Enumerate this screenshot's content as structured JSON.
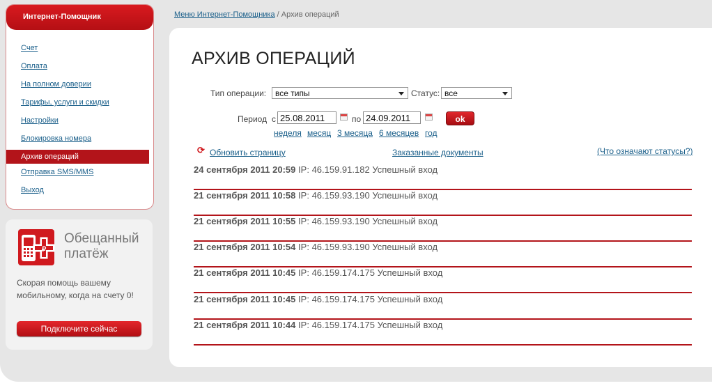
{
  "sidebar": {
    "title": "Интернет-Помощник",
    "items": [
      {
        "label": "Счет"
      },
      {
        "label": "Оплата"
      },
      {
        "label": "На полном доверии"
      },
      {
        "label": "Тарифы, услуги и скидки"
      },
      {
        "label": "Настройки"
      },
      {
        "label": "Блокировка номера"
      },
      {
        "label": "Архив операций",
        "active": true
      },
      {
        "label": "Отправка SMS/MMS"
      },
      {
        "label": "Выход"
      }
    ]
  },
  "promo": {
    "title_line1": "Обещанный",
    "title_line2": "платёж",
    "text": "Скорая помощь вашему мобильному, когда на счету 0!",
    "button": "Подключите сейчас"
  },
  "breadcrumb": {
    "parent": "Меню Интернет-Помощника",
    "separator": "/",
    "current": "Архив операций"
  },
  "page": {
    "title": "АРХИВ ОПЕРАЦИЙ"
  },
  "filters": {
    "type_label": "Тип операции:",
    "type_value": "все типы",
    "status_label": "Статус:",
    "status_value": "все",
    "period_label": "Период",
    "from_label": "с",
    "from_date": "25.08.2011",
    "to_label": "по",
    "to_date": "24.09.2011",
    "ok": "ok",
    "quick_periods": [
      "неделя",
      "месяц",
      "3 месяца",
      "6 месяцев",
      "год"
    ]
  },
  "toolbar": {
    "refresh": "Обновить страницу",
    "documents": "Заказанные документы",
    "statuses_help": "(Что означают статусы?)"
  },
  "operations": [
    {
      "datetime": "24 сентября 2011 20:59",
      "ip_label": "IP:",
      "ip": "46.159.91.182",
      "status": "Успешный вход"
    },
    {
      "datetime": "21 сентября 2011 10:58",
      "ip_label": "IP:",
      "ip": "46.159.93.190",
      "status": "Успешный вход"
    },
    {
      "datetime": "21 сентября 2011 10:55",
      "ip_label": "IP:",
      "ip": "46.159.93.190",
      "status": "Успешный вход"
    },
    {
      "datetime": "21 сентября 2011 10:54",
      "ip_label": "IP:",
      "ip": "46.159.93.190",
      "status": "Успешный вход"
    },
    {
      "datetime": "21 сентября 2011 10:45",
      "ip_label": "IP:",
      "ip": "46.159.174.175",
      "status": "Успешный вход"
    },
    {
      "datetime": "21 сентября 2011 10:45",
      "ip_label": "IP:",
      "ip": "46.159.174.175",
      "status": "Успешный вход"
    },
    {
      "datetime": "21 сентября 2011 10:44",
      "ip_label": "IP:",
      "ip": "46.159.174.175",
      "status": "Успешный вход"
    }
  ],
  "colors": {
    "accent": "#b3141a",
    "link": "#1a5f8a",
    "frame": "#e6e6e6"
  }
}
